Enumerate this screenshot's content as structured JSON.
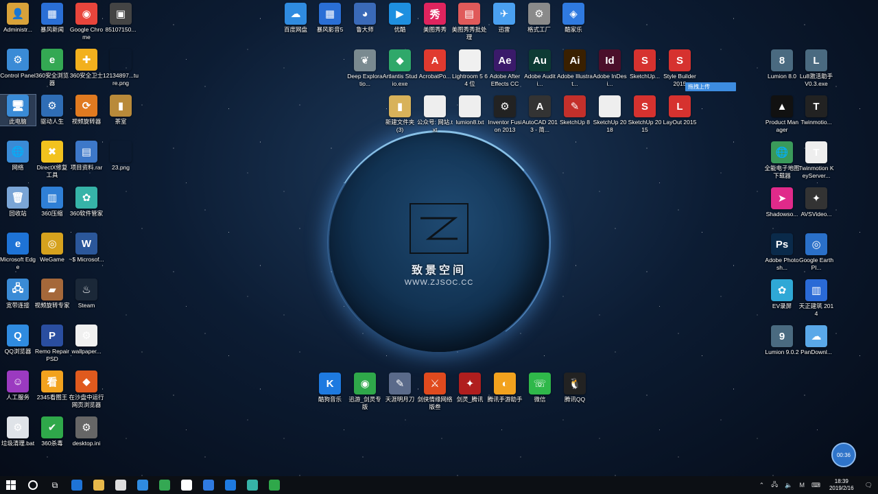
{
  "watermark": {
    "title": "致景空间",
    "url": "WWW.ZJSOC.CC"
  },
  "tooltip": "拖拽上传",
  "clock_bubble": "00:36",
  "left_icons": [
    {
      "label": "Administr...",
      "color": "#d8a23a",
      "glyph": "👤"
    },
    {
      "label": "暴风新闻",
      "color": "#2a6fd6",
      "glyph": "▦"
    },
    {
      "label": "Google Chrome",
      "color": "#e8453c",
      "glyph": "◉"
    },
    {
      "label": "85107150...",
      "color": "#444",
      "glyph": "▣"
    },
    {
      "label": "Control Panel",
      "color": "#3a8bd6",
      "glyph": "⚙"
    },
    {
      "label": "360安全浏览器",
      "color": "#34a853",
      "glyph": "e"
    },
    {
      "label": "360安全卫士",
      "color": "#f2b01e",
      "glyph": "✚"
    },
    {
      "label": "12134897...ture.png",
      "color": "transparent",
      "glyph": ""
    },
    {
      "label": "此电脑",
      "color": "#3a8bd6",
      "glyph": "🖥"
    },
    {
      "label": "驱动人生",
      "color": "#2f6db5",
      "glyph": "⚙"
    },
    {
      "label": "视频旋转器",
      "color": "#e07a20",
      "glyph": "⟳"
    },
    {
      "label": "茶室",
      "color": "#b98a3a",
      "glyph": "▮"
    },
    {
      "label": "网络",
      "color": "#3a8bd6",
      "glyph": "🌐"
    },
    {
      "label": "DirectX修复工具",
      "color": "#f2c21e",
      "glyph": "✖"
    },
    {
      "label": "项目资料.rar",
      "color": "#3d78c9",
      "glyph": "▤"
    },
    {
      "label": "23.png",
      "color": "transparent",
      "glyph": ""
    },
    {
      "label": "回收站",
      "color": "#7aa5d6",
      "glyph": "🗑"
    },
    {
      "label": "360压缩",
      "color": "#2f7fd6",
      "glyph": "▥"
    },
    {
      "label": "360软件管家",
      "color": "#36b3a8",
      "glyph": "✿"
    },
    {
      "label": "Microsoft Edge",
      "color": "#1e73d6",
      "glyph": "e"
    },
    {
      "label": "WeGame",
      "color": "#d6a21e",
      "glyph": "◎"
    },
    {
      "label": "~$ Microsof...",
      "color": "#2b579a",
      "glyph": "W"
    },
    {
      "label": "宽带连接",
      "color": "#3a8bd6",
      "glyph": "🖧"
    },
    {
      "label": "视频旋转专家",
      "color": "#a5683a",
      "glyph": "▰"
    },
    {
      "label": "Steam",
      "color": "#1b2838",
      "glyph": "♨"
    },
    {
      "label": "QQ浏览器",
      "color": "#2f8be0",
      "glyph": "Q"
    },
    {
      "label": "Remo Repair PSD",
      "color": "#2a4ea0",
      "glyph": "P"
    },
    {
      "label": "wallpaper...",
      "color": "#f0f0f0",
      "glyph": "⚙"
    },
    {
      "label": "人工服务",
      "color": "#9b3ac0",
      "glyph": "☺"
    },
    {
      "label": "2345看图王",
      "color": "#f2a21e",
      "glyph": "看"
    },
    {
      "label": "在沙盘中运行网页浏览器",
      "color": "#e05a1e",
      "glyph": "◆"
    },
    {
      "label": "垃圾清理.bat",
      "color": "#dfe3e8",
      "glyph": "⚙"
    },
    {
      "label": "360杀毒",
      "color": "#2fa84a",
      "glyph": "✔"
    },
    {
      "label": "desktop.ini",
      "color": "#666",
      "glyph": "⚙"
    }
  ],
  "top_icons": [
    {
      "label": "百度网盘",
      "color": "#2f8be0",
      "glyph": "☁"
    },
    {
      "label": "暴风影音5",
      "color": "#2a6fd6",
      "glyph": "▦"
    },
    {
      "label": "鲁大师",
      "color": "#3a6ab8",
      "glyph": "◕"
    },
    {
      "label": "优酷",
      "color": "#1e8fe0",
      "glyph": "▶"
    },
    {
      "label": "美图秀秀",
      "color": "#e0245e",
      "glyph": "秀"
    },
    {
      "label": "美图秀秀批处理",
      "color": "#e05a5a",
      "glyph": "▤"
    },
    {
      "label": "迅雷",
      "color": "#4aa0f0",
      "glyph": "✈"
    },
    {
      "label": "格式工厂",
      "color": "#8a8a8a",
      "glyph": "⚙"
    },
    {
      "label": "酷家乐",
      "color": "#2f7ae0",
      "glyph": "◈"
    }
  ],
  "mid_icons": [
    {
      "label": "Deep Exploratio...",
      "color": "#7a8a90",
      "glyph": "❦"
    },
    {
      "label": "Artlantis Studio.exe",
      "color": "#2fa86a",
      "glyph": "◆"
    },
    {
      "label": "AcrobatPo...",
      "color": "#e03a2f",
      "glyph": "A"
    },
    {
      "label": "Lightroom 5 64 位",
      "color": "#f0f0f0",
      "glyph": ""
    },
    {
      "label": "Adobe After Effects CC",
      "color": "#3a1a6a",
      "glyph": "Ae"
    },
    {
      "label": "Adobe Auditi...",
      "color": "#0d3b34",
      "glyph": "Au"
    },
    {
      "label": "Adobe Illustrat...",
      "color": "#3a2000",
      "glyph": "Ai"
    },
    {
      "label": "Adobe InDesi...",
      "color": "#4a0f2a",
      "glyph": "Id"
    },
    {
      "label": "SketchUp...",
      "color": "#d6322f",
      "glyph": "S"
    },
    {
      "label": "Style Builder 2015",
      "color": "#d6322f",
      "glyph": "S"
    }
  ],
  "mid_icons2": [
    {
      "label": "新建文件夹 (3)",
      "color": "#d8b25a",
      "glyph": "▮"
    },
    {
      "label": "公众号: 网站.txt",
      "color": "#eeeeee",
      "glyph": ""
    },
    {
      "label": "lumion8.txt",
      "color": "#eeeeee",
      "glyph": ""
    },
    {
      "label": "Inventor Fusion 2013",
      "color": "#222",
      "glyph": "⚙"
    },
    {
      "label": "AutoCAD 2013 - 简...",
      "color": "#333",
      "glyph": "A"
    },
    {
      "label": "SketchUp 8",
      "color": "#c4302b",
      "glyph": "✎"
    },
    {
      "label": "SketchUp 2018",
      "color": "#eeeeee",
      "glyph": ""
    },
    {
      "label": "SketchUp 2015",
      "color": "#d6322f",
      "glyph": "S"
    },
    {
      "label": "LayOut 2015",
      "color": "#d6322f",
      "glyph": "L"
    }
  ],
  "right_icons": [
    {
      "label": "Lumion 8.0",
      "color": "#4a6a80",
      "glyph": "8"
    },
    {
      "label": "Lu8激活助手 V0.3.exe",
      "color": "#4a6a80",
      "glyph": "L"
    },
    {
      "label": "Product Manager",
      "color": "#111",
      "glyph": "▲"
    },
    {
      "label": "Twinmotio...",
      "color": "#222",
      "glyph": "T"
    },
    {
      "label": "全能电子地图下载器",
      "color": "#3a9a5a",
      "glyph": "🌐"
    },
    {
      "label": "Twinmotion KeyServer...",
      "color": "#eee",
      "glyph": "T"
    },
    {
      "label": "Shadowso...",
      "color": "#e02a8a",
      "glyph": "➤"
    },
    {
      "label": "AVSVideo...",
      "color": "#333",
      "glyph": "✦"
    },
    {
      "label": "Adobe Photosh...",
      "color": "#0a2a4a",
      "glyph": "Ps"
    },
    {
      "label": "Google Earth Pl...",
      "color": "#2a70c9",
      "glyph": "◎"
    },
    {
      "label": "EV录屏",
      "color": "#2fa8d6",
      "glyph": "✿"
    },
    {
      "label": "天正建筑 2014",
      "color": "#2a6ad6",
      "glyph": "▥"
    },
    {
      "label": "Lumion 9.0.2",
      "color": "#4a6a80",
      "glyph": "9"
    },
    {
      "label": "PanDownl...",
      "color": "#5aa8e8",
      "glyph": "☁"
    }
  ],
  "bottom_icons": [
    {
      "label": "酷狗音乐",
      "color": "#1e7ae0",
      "glyph": "K"
    },
    {
      "label": "迅游_剑灵专版",
      "color": "#2fa84a",
      "glyph": "◉"
    },
    {
      "label": "天涯明月刀",
      "color": "#5a6a8a",
      "glyph": "✎"
    },
    {
      "label": "剑侠情缘网络版叁",
      "color": "#e04a1e",
      "glyph": "⚔"
    },
    {
      "label": "剑灵_腾讯",
      "color": "#b01e1e",
      "glyph": "✦"
    },
    {
      "label": "腾讯手游助手",
      "color": "#f2a21e",
      "glyph": "◐"
    },
    {
      "label": "微信",
      "color": "#2fb84a",
      "glyph": "☏"
    },
    {
      "label": "腾讯QQ",
      "color": "#222",
      "glyph": "🐧"
    }
  ],
  "taskbar": {
    "apps": [
      {
        "name": "edge",
        "color": "#1e73d6"
      },
      {
        "name": "explorer",
        "color": "#e8b84a"
      },
      {
        "name": "store",
        "color": "#ddd"
      },
      {
        "name": "qq-browser",
        "color": "#2f8be0"
      },
      {
        "name": "360-browser",
        "color": "#34a853"
      },
      {
        "name": "mail",
        "color": "#fff"
      },
      {
        "name": "kujiale",
        "color": "#2f7ae0"
      },
      {
        "name": "kugou",
        "color": "#1e7ae0"
      },
      {
        "name": "360-soft",
        "color": "#36b3a8"
      },
      {
        "name": "xunyou",
        "color": "#2fa84a"
      }
    ],
    "tray_ime": "M",
    "time": "18:39",
    "date": "2019/2/16"
  }
}
